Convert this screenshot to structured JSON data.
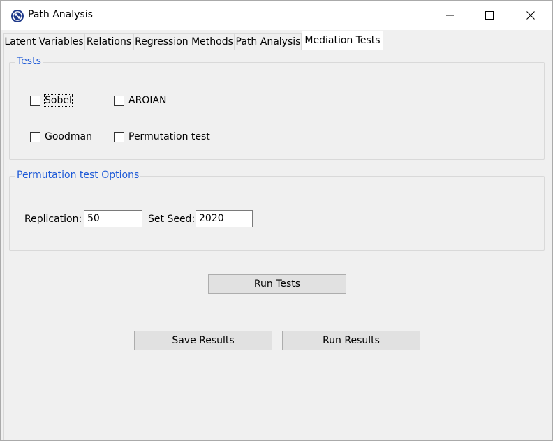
{
  "window": {
    "title": "Path Analysis"
  },
  "tabs": [
    {
      "label": "Latent Variables"
    },
    {
      "label": "Relations"
    },
    {
      "label": "Regression Methods"
    },
    {
      "label": "Path Analysis"
    },
    {
      "label": "Mediation Tests"
    }
  ],
  "active_tab": "Mediation Tests",
  "tests_group": {
    "legend": "Tests",
    "options": [
      {
        "label": "Sobel",
        "checked": false
      },
      {
        "label": "AROIAN",
        "checked": false
      },
      {
        "label": "Goodman",
        "checked": false
      },
      {
        "label": "Permutation test",
        "checked": false
      }
    ]
  },
  "permutation_group": {
    "legend": "Permutation test Options",
    "replication_label": "Replication:",
    "replication_value": "50",
    "seed_label": "Set Seed:",
    "seed_value": "2020"
  },
  "buttons": {
    "run_tests": "Run Tests",
    "save_results": "Save Results",
    "run_results": "Run Results"
  },
  "colors": {
    "legend": "#1e5ad7",
    "active_tab_bg": "#ffffff",
    "button_bg": "#e1e1e1"
  }
}
